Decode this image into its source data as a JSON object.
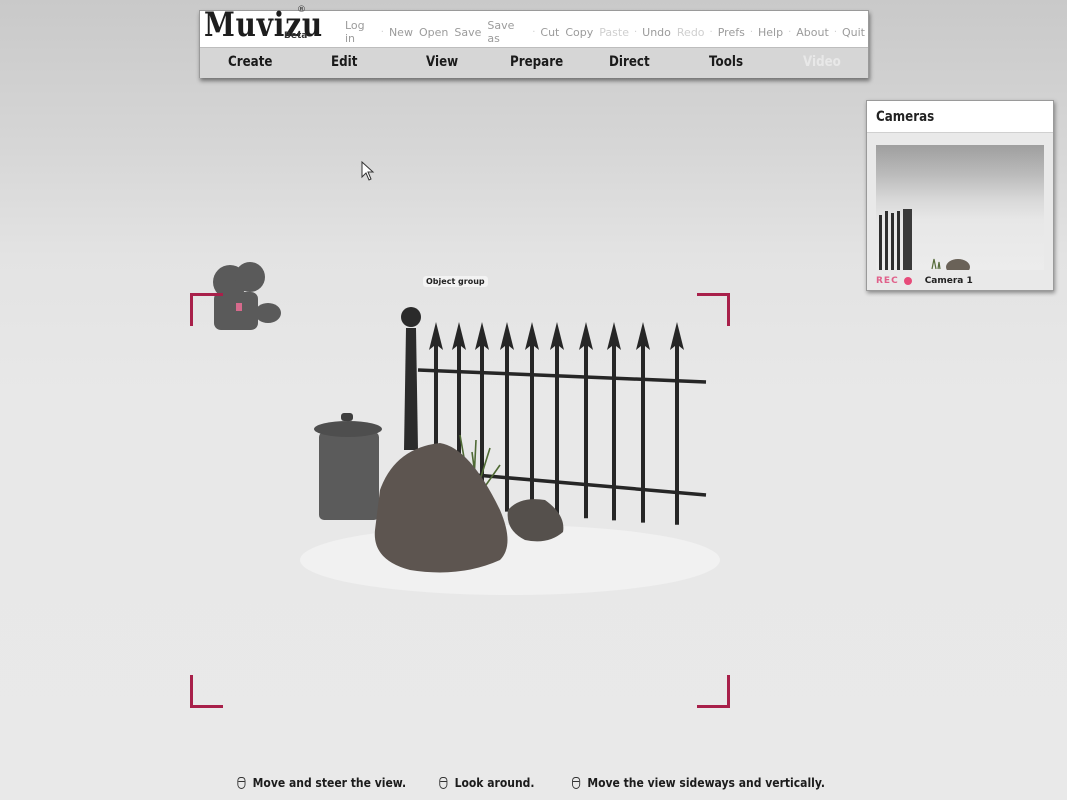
{
  "app": {
    "logo": "Muvizu",
    "logo_mark": "®",
    "logo_badge": "Beta"
  },
  "top_menu": [
    {
      "label": "Log in",
      "enabled": true
    },
    {
      "label": "New",
      "enabled": true
    },
    {
      "label": "Open",
      "enabled": true
    },
    {
      "label": "Save",
      "enabled": true
    },
    {
      "label": "Save as",
      "enabled": true
    },
    {
      "label": "Cut",
      "enabled": true
    },
    {
      "label": "Copy",
      "enabled": true
    },
    {
      "label": "Paste",
      "enabled": false
    },
    {
      "label": "Undo",
      "enabled": true
    },
    {
      "label": "Redo",
      "enabled": false
    },
    {
      "label": "Prefs",
      "enabled": true
    },
    {
      "label": "Help",
      "enabled": true
    },
    {
      "label": "About",
      "enabled": true
    },
    {
      "label": "Quit",
      "enabled": true
    }
  ],
  "main_tabs": [
    {
      "label": "Create",
      "enabled": true
    },
    {
      "label": "Edit",
      "enabled": true
    },
    {
      "label": "View",
      "enabled": true
    },
    {
      "label": "Prepare",
      "enabled": true
    },
    {
      "label": "Direct",
      "enabled": true
    },
    {
      "label": "Tools",
      "enabled": true
    },
    {
      "label": "Video",
      "enabled": false
    }
  ],
  "cameras_panel": {
    "title": "Cameras",
    "rec_label": "REC",
    "camera_name": "Camera 1"
  },
  "viewport": {
    "selected_object_label": "Object group",
    "frame_color": "#a8204a"
  },
  "hints": [
    {
      "icon": "left-mouse-icon",
      "text": "Move and steer the view."
    },
    {
      "icon": "right-mouse-icon",
      "text": "Look around."
    },
    {
      "icon": "middle-mouse-icon",
      "text": "Move the view sideways and vertically."
    }
  ]
}
